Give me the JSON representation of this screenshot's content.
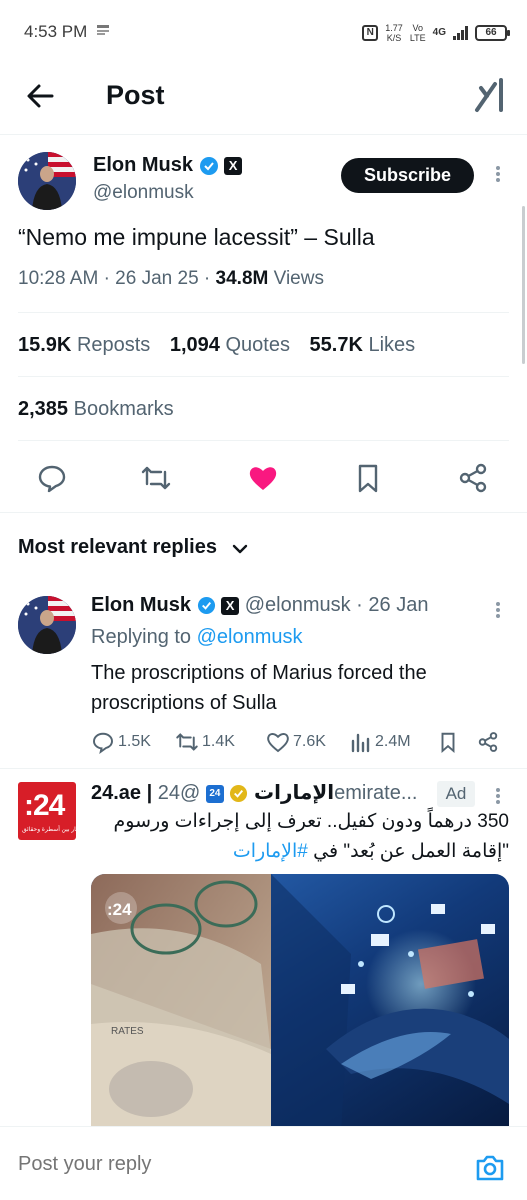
{
  "status_bar": {
    "time": "4:53 PM",
    "notif_icon": "app-notification-icon",
    "net_speed": "1.77",
    "net_unit": "K/S",
    "volte_top": "Vo",
    "volte_bottom": "LTE",
    "network": "4G",
    "battery": "66"
  },
  "header": {
    "title": "Post",
    "back_icon": "arrow-left-icon",
    "grok_icon": "grok-icon"
  },
  "post": {
    "author_name": "Elon Musk",
    "handle": "@elonmusk",
    "affiliate_badge": "X",
    "subscribe_label": "Subscribe",
    "text": "“Nemo me impune lacessit” – Sulla",
    "time": "10:28 AM",
    "date": "26 Jan 25",
    "views_count": "34.8M",
    "views_label": "Views",
    "separator": "·",
    "reposts_count": "15.9K",
    "reposts_label": "Reposts",
    "quotes_count": "1,094",
    "quotes_label": "Quotes",
    "likes_count": "55.7K",
    "likes_label": "Likes",
    "bookmarks_count": "2,385",
    "bookmarks_label": "Bookmarks",
    "liked": true,
    "like_color": "#f91880"
  },
  "replies_sort": {
    "label": "Most relevant replies"
  },
  "reply": {
    "author_name": "Elon Musk",
    "handle": "@elonmusk",
    "separator": "·",
    "date": "26 Jan",
    "affiliate_badge": "X",
    "replying_label": "Replying to",
    "replying_to": "@elonmusk",
    "text": "The proscriptions of Marius forced the proscriptions of Sulla",
    "replies": "1.5K",
    "reposts": "1.4K",
    "likes": "7.6K",
    "views": "2.4M"
  },
  "ad": {
    "logo_text": ":24",
    "logo_sub": "أخبار بين أسطرة وحقائق",
    "author_name": "24.ae | الإمارات",
    "handle": "@24emirate...",
    "affiliate_badge": "24",
    "ad_label": "Ad",
    "text_line1": "350 درهماً ودون كفيل.. تعرف إلى إجراءات ورسوم",
    "text_line2": "\"إقامة العمل عن بُعد\" في",
    "hashtag": "#الإمارات",
    "image_watermark": ":24",
    "stamp_text": "RATES"
  },
  "composer": {
    "placeholder": "Post your reply",
    "camera_icon": "camera-icon"
  },
  "colors": {
    "accent": "#1d9bf0",
    "like": "#f91880",
    "text": "#0f1419",
    "secondary": "#536471",
    "ad_brand": "#d71e28"
  }
}
